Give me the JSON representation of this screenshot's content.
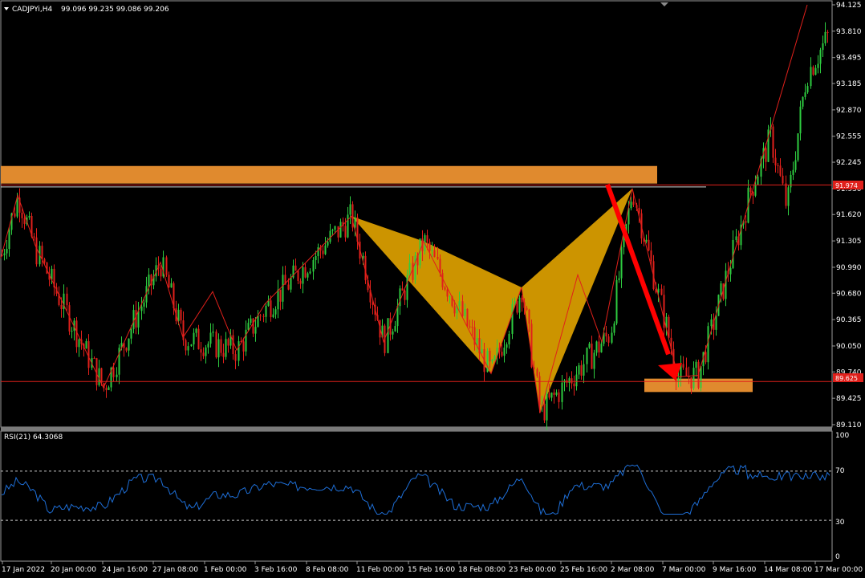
{
  "header": {
    "symbol": "CADJPYi,H4",
    "ohlc": "99.096 99.235 99.086 99.206"
  },
  "colors": {
    "background": "#000000",
    "bull_candle": "#2ecc40",
    "bear_candle": "#e0201b",
    "zigzag": "#e0201b",
    "zone": "#e08a2e",
    "pattern_fill": "#e8a800",
    "arrow": "#ff0000",
    "rsi_line": "#1e6fd8",
    "axis_text": "#ffffff"
  },
  "price_axis": {
    "ticks": [
      "94.125",
      "93.810",
      "93.495",
      "93.185",
      "92.870",
      "92.555",
      "92.245",
      "91.930",
      "91.620",
      "91.305",
      "90.990",
      "90.680",
      "90.365",
      "90.050",
      "89.740",
      "89.425",
      "89.110"
    ],
    "tag_upper": "91.974",
    "tag_lower": "89.625"
  },
  "rsi": {
    "label": "RSI(21) 64.3068",
    "levels": [
      "100",
      "70",
      "30",
      "0"
    ]
  },
  "time_axis": {
    "labels": [
      "17 Jan 2022",
      "20 Jan 00:00",
      "24 Jan 16:00",
      "27 Jan 08:00",
      "1 Feb 00:00",
      "3 Feb 16:00",
      "8 Feb 08:00",
      "11 Feb 00:00",
      "15 Feb 16:00",
      "18 Feb 08:00",
      "23 Feb 00:00",
      "25 Feb 16:00",
      "2 Mar 08:00",
      "7 Mar 00:00",
      "9 Mar 16:00",
      "14 Mar 08:00",
      "17 Mar 00:00"
    ]
  },
  "chart_data": {
    "type": "line",
    "title": "CADJPYi,H4",
    "ylim": [
      89.11,
      94.125
    ],
    "zigzag": [
      {
        "x": "17 Jan 2022",
        "y": 91.1
      },
      {
        "x": "17 Jan",
        "y": 91.85
      },
      {
        "x": "20 Jan",
        "y": 91.1
      },
      {
        "x": "24 Jan",
        "y": 89.55
      },
      {
        "x": "27 Jan",
        "y": 91.05
      },
      {
        "x": "27 Jan",
        "y": 90.15
      },
      {
        "x": "1 Feb",
        "y": 90.0
      },
      {
        "x": "3 Feb",
        "y": 90.75
      },
      {
        "x": "8 Feb",
        "y": 91.6
      },
      {
        "x": "11 Feb",
        "y": 90.1
      },
      {
        "x": "15 Feb",
        "y": 91.3
      },
      {
        "x": "18 Feb",
        "y": 89.72
      },
      {
        "x": "21 Feb",
        "y": 90.75
      },
      {
        "x": "23 Feb",
        "y": 89.25
      },
      {
        "x": "2 Mar",
        "y": 91.93
      },
      {
        "x": "7 Mar",
        "y": 89.68
      },
      {
        "x": "17 Mar",
        "y": 94.1
      }
    ],
    "resistance": 91.974,
    "support": 89.625,
    "rsi_levels": [
      70,
      30
    ],
    "rsi_last": 64.3068
  }
}
